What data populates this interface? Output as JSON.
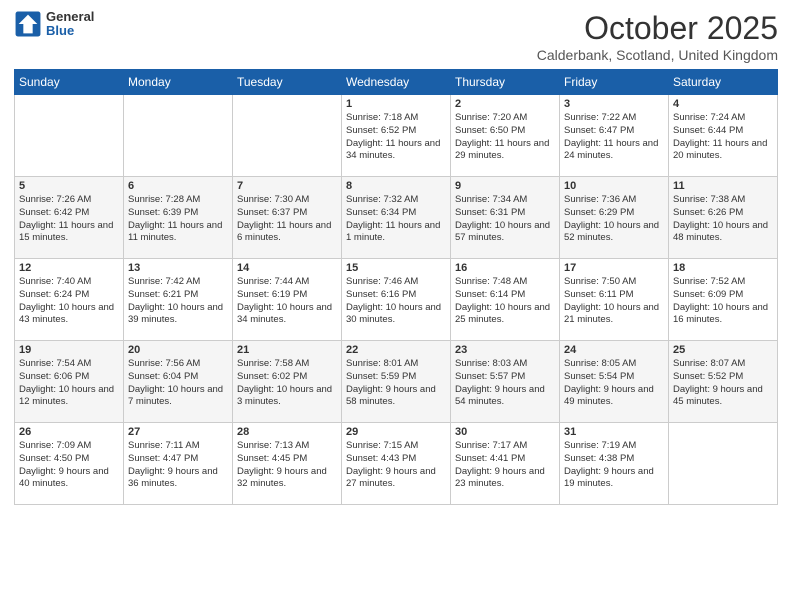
{
  "logo": {
    "general": "General",
    "blue": "Blue"
  },
  "header": {
    "month": "October 2025",
    "location": "Calderbank, Scotland, United Kingdom"
  },
  "weekdays": [
    "Sunday",
    "Monday",
    "Tuesday",
    "Wednesday",
    "Thursday",
    "Friday",
    "Saturday"
  ],
  "weeks": [
    [
      {
        "day": "",
        "sunrise": "",
        "sunset": "",
        "daylight": ""
      },
      {
        "day": "",
        "sunrise": "",
        "sunset": "",
        "daylight": ""
      },
      {
        "day": "",
        "sunrise": "",
        "sunset": "",
        "daylight": ""
      },
      {
        "day": "1",
        "sunrise": "Sunrise: 7:18 AM",
        "sunset": "Sunset: 6:52 PM",
        "daylight": "Daylight: 11 hours and 34 minutes."
      },
      {
        "day": "2",
        "sunrise": "Sunrise: 7:20 AM",
        "sunset": "Sunset: 6:50 PM",
        "daylight": "Daylight: 11 hours and 29 minutes."
      },
      {
        "day": "3",
        "sunrise": "Sunrise: 7:22 AM",
        "sunset": "Sunset: 6:47 PM",
        "daylight": "Daylight: 11 hours and 24 minutes."
      },
      {
        "day": "4",
        "sunrise": "Sunrise: 7:24 AM",
        "sunset": "Sunset: 6:44 PM",
        "daylight": "Daylight: 11 hours and 20 minutes."
      }
    ],
    [
      {
        "day": "5",
        "sunrise": "Sunrise: 7:26 AM",
        "sunset": "Sunset: 6:42 PM",
        "daylight": "Daylight: 11 hours and 15 minutes."
      },
      {
        "day": "6",
        "sunrise": "Sunrise: 7:28 AM",
        "sunset": "Sunset: 6:39 PM",
        "daylight": "Daylight: 11 hours and 11 minutes."
      },
      {
        "day": "7",
        "sunrise": "Sunrise: 7:30 AM",
        "sunset": "Sunset: 6:37 PM",
        "daylight": "Daylight: 11 hours and 6 minutes."
      },
      {
        "day": "8",
        "sunrise": "Sunrise: 7:32 AM",
        "sunset": "Sunset: 6:34 PM",
        "daylight": "Daylight: 11 hours and 1 minute."
      },
      {
        "day": "9",
        "sunrise": "Sunrise: 7:34 AM",
        "sunset": "Sunset: 6:31 PM",
        "daylight": "Daylight: 10 hours and 57 minutes."
      },
      {
        "day": "10",
        "sunrise": "Sunrise: 7:36 AM",
        "sunset": "Sunset: 6:29 PM",
        "daylight": "Daylight: 10 hours and 52 minutes."
      },
      {
        "day": "11",
        "sunrise": "Sunrise: 7:38 AM",
        "sunset": "Sunset: 6:26 PM",
        "daylight": "Daylight: 10 hours and 48 minutes."
      }
    ],
    [
      {
        "day": "12",
        "sunrise": "Sunrise: 7:40 AM",
        "sunset": "Sunset: 6:24 PM",
        "daylight": "Daylight: 10 hours and 43 minutes."
      },
      {
        "day": "13",
        "sunrise": "Sunrise: 7:42 AM",
        "sunset": "Sunset: 6:21 PM",
        "daylight": "Daylight: 10 hours and 39 minutes."
      },
      {
        "day": "14",
        "sunrise": "Sunrise: 7:44 AM",
        "sunset": "Sunset: 6:19 PM",
        "daylight": "Daylight: 10 hours and 34 minutes."
      },
      {
        "day": "15",
        "sunrise": "Sunrise: 7:46 AM",
        "sunset": "Sunset: 6:16 PM",
        "daylight": "Daylight: 10 hours and 30 minutes."
      },
      {
        "day": "16",
        "sunrise": "Sunrise: 7:48 AM",
        "sunset": "Sunset: 6:14 PM",
        "daylight": "Daylight: 10 hours and 25 minutes."
      },
      {
        "day": "17",
        "sunrise": "Sunrise: 7:50 AM",
        "sunset": "Sunset: 6:11 PM",
        "daylight": "Daylight: 10 hours and 21 minutes."
      },
      {
        "day": "18",
        "sunrise": "Sunrise: 7:52 AM",
        "sunset": "Sunset: 6:09 PM",
        "daylight": "Daylight: 10 hours and 16 minutes."
      }
    ],
    [
      {
        "day": "19",
        "sunrise": "Sunrise: 7:54 AM",
        "sunset": "Sunset: 6:06 PM",
        "daylight": "Daylight: 10 hours and 12 minutes."
      },
      {
        "day": "20",
        "sunrise": "Sunrise: 7:56 AM",
        "sunset": "Sunset: 6:04 PM",
        "daylight": "Daylight: 10 hours and 7 minutes."
      },
      {
        "day": "21",
        "sunrise": "Sunrise: 7:58 AM",
        "sunset": "Sunset: 6:02 PM",
        "daylight": "Daylight: 10 hours and 3 minutes."
      },
      {
        "day": "22",
        "sunrise": "Sunrise: 8:01 AM",
        "sunset": "Sunset: 5:59 PM",
        "daylight": "Daylight: 9 hours and 58 minutes."
      },
      {
        "day": "23",
        "sunrise": "Sunrise: 8:03 AM",
        "sunset": "Sunset: 5:57 PM",
        "daylight": "Daylight: 9 hours and 54 minutes."
      },
      {
        "day": "24",
        "sunrise": "Sunrise: 8:05 AM",
        "sunset": "Sunset: 5:54 PM",
        "daylight": "Daylight: 9 hours and 49 minutes."
      },
      {
        "day": "25",
        "sunrise": "Sunrise: 8:07 AM",
        "sunset": "Sunset: 5:52 PM",
        "daylight": "Daylight: 9 hours and 45 minutes."
      }
    ],
    [
      {
        "day": "26",
        "sunrise": "Sunrise: 7:09 AM",
        "sunset": "Sunset: 4:50 PM",
        "daylight": "Daylight: 9 hours and 40 minutes."
      },
      {
        "day": "27",
        "sunrise": "Sunrise: 7:11 AM",
        "sunset": "Sunset: 4:47 PM",
        "daylight": "Daylight: 9 hours and 36 minutes."
      },
      {
        "day": "28",
        "sunrise": "Sunrise: 7:13 AM",
        "sunset": "Sunset: 4:45 PM",
        "daylight": "Daylight: 9 hours and 32 minutes."
      },
      {
        "day": "29",
        "sunrise": "Sunrise: 7:15 AM",
        "sunset": "Sunset: 4:43 PM",
        "daylight": "Daylight: 9 hours and 27 minutes."
      },
      {
        "day": "30",
        "sunrise": "Sunrise: 7:17 AM",
        "sunset": "Sunset: 4:41 PM",
        "daylight": "Daylight: 9 hours and 23 minutes."
      },
      {
        "day": "31",
        "sunrise": "Sunrise: 7:19 AM",
        "sunset": "Sunset: 4:38 PM",
        "daylight": "Daylight: 9 hours and 19 minutes."
      },
      {
        "day": "",
        "sunrise": "",
        "sunset": "",
        "daylight": ""
      }
    ]
  ]
}
